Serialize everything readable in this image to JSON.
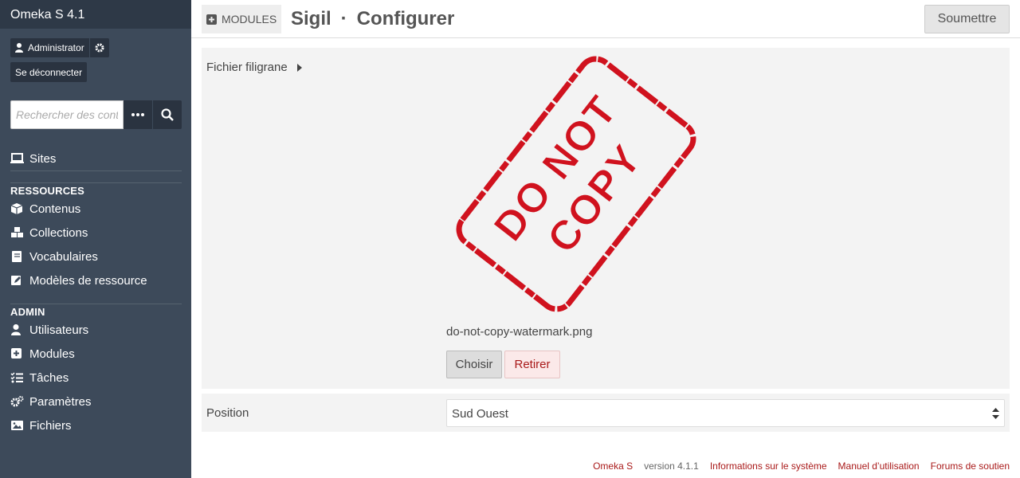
{
  "app": {
    "title": "Omeka S 4.1"
  },
  "user": {
    "name": "Administrator",
    "logout_label": "Se déconnecter"
  },
  "search": {
    "placeholder": "Rechercher des contenus"
  },
  "nav": {
    "sites": "Sites",
    "resources_heading": "RESSOURCES",
    "resources": [
      "Contenus",
      "Collections",
      "Vocabulaires",
      "Modèles de ressource"
    ],
    "admin_heading": "ADMIN",
    "admin": [
      "Utilisateurs",
      "Modules",
      "Tâches",
      "Paramètres",
      "Fichiers"
    ]
  },
  "header": {
    "section_label": "Modules",
    "module_name": "Sigil",
    "separator": "·",
    "action": "Configurer",
    "submit_label": "Soumettre"
  },
  "form": {
    "watermark_label": "Fichier filigrane",
    "stamp_line1": "DO NOT",
    "stamp_line2": "COPY",
    "filename": "do-not-copy-watermark.png",
    "choose_label": "Choisir",
    "remove_label": "Retirer",
    "position_label": "Position",
    "position_value": "Sud Ouest"
  },
  "footer": {
    "product": "Omeka S",
    "version": "version 4.1.1",
    "system_info": "Informations sur le système",
    "manual": "Manuel d’utilisation",
    "forums": "Forums de soutien"
  },
  "colors": {
    "sidebar": "#3d4a5a",
    "accent": "#a91919",
    "stamp": "#d0121e"
  }
}
